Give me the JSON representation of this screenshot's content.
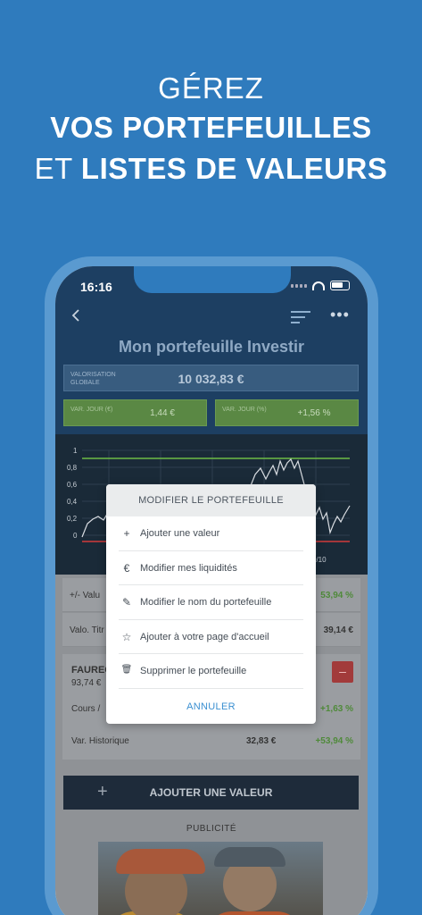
{
  "headline": {
    "line1": "GÉREZ",
    "line2": "VOS PORTEFEUILLES",
    "line3_prefix": "ET",
    "line3_bold": "LISTES DE VALEURS"
  },
  "status_bar": {
    "time": "16:16"
  },
  "header": {
    "title": "Mon portefeuille Investir"
  },
  "summary": {
    "valorisation_label": "VALORISATION GLOBALE",
    "valorisation_value": "10 032,83 €",
    "var_jour_eur_label": "VAR. JOUR (€)",
    "var_jour_eur_value": "1,44 €",
    "var_jour_pct_label": "VAR. JOUR (%)",
    "var_jour_pct_value": "+1,56 %"
  },
  "chart": {
    "y_ticks": [
      "1",
      "0,8",
      "0,6",
      "0,4",
      "0,2",
      "0"
    ],
    "x_label_visible": "0/10",
    "colors": {
      "upper_line": "#6dbb45",
      "lower_line": "#d23b3b",
      "series": "#d9dde2"
    }
  },
  "rows": {
    "plus_moins_label": "+/- Valu",
    "plus_moins_value": "53,94 %",
    "valo_titres_label": "Valo. Titr",
    "valo_titres_value": "39,14 €"
  },
  "holding": {
    "name": "FAUREC",
    "price": "93,74 €",
    "delete_label": "–",
    "cours_label": "Cours /",
    "cours_pct": "+1,63 %",
    "hist_label": "Var. Historique",
    "hist_value": "32,83 €",
    "hist_pct": "+53,94 %"
  },
  "add_button": {
    "label": "AJOUTER UNE VALEUR",
    "plus": "+"
  },
  "publicite": "PUBLICITÉ",
  "modal": {
    "title": "MODIFIER LE PORTEFEUILLE",
    "items": [
      {
        "icon": "+",
        "label": "Ajouter une valeur"
      },
      {
        "icon": "€",
        "label": "Modifier mes liquidités"
      },
      {
        "icon": "✎",
        "label": "Modifier le nom du portefeuille"
      },
      {
        "icon": "☆",
        "label": "Ajouter à votre page d'accueil"
      },
      {
        "icon": "🗑",
        "label": "Supprimer le portefeuille"
      }
    ],
    "cancel": "ANNULER"
  }
}
